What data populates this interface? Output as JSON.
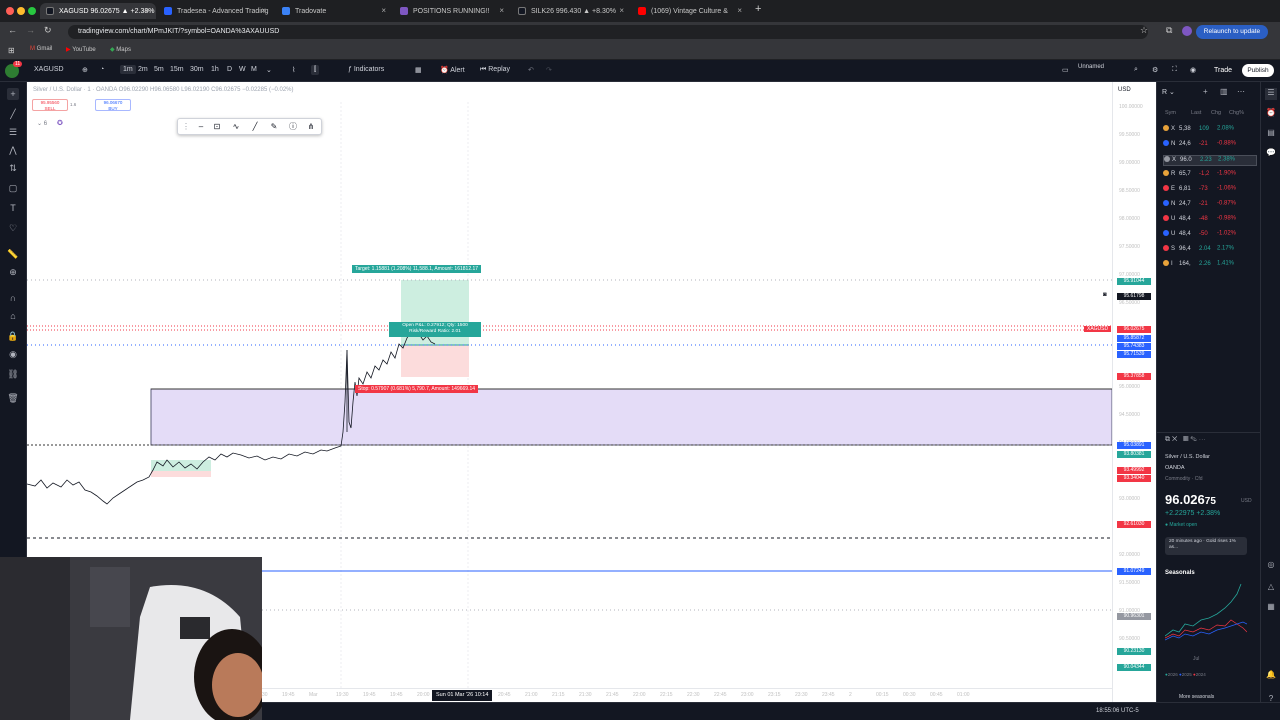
{
  "browser": {
    "tabs": [
      {
        "label": "XAGUSD 96.02675 ▲ +2.38%",
        "active": true
      },
      {
        "label": "Tradesea - Advanced Trading"
      },
      {
        "label": "Tradovate"
      },
      {
        "label": "POSITIONS RUNNING!!"
      },
      {
        "label": "SILK26 996.430 ▲ +8.30%"
      },
      {
        "label": "(1069) Vintage Culture &"
      }
    ],
    "url": "tradingview.com/chart/MPmJKIT/?symbol=OANDA%3AXAUUSD",
    "relaunch_label": "Relaunch to update",
    "bookmarks": [
      "Gmail",
      "YouTube",
      "Maps"
    ]
  },
  "toolbar": {
    "avatar_badge": "11",
    "symbol": "XAGUSD",
    "intervals": [
      "1m",
      "2m",
      "5m",
      "15m",
      "30m",
      "1h",
      "D",
      "W",
      "M"
    ],
    "active_interval": "1m",
    "indicators_label": "Indicators",
    "alert_label": "Alert",
    "replay_label": "Replay",
    "layout_label": "Unnamed",
    "trade_label": "Trade",
    "publish_label": "Publish"
  },
  "chart": {
    "legend": "Silver / U.S. Dollar · 1 · OANDA   O96.02290 H96.06580 L96.02190 C96.02675 −0.02285 (−0.02%)",
    "sell": {
      "price": "95.95560",
      "label": "SELL"
    },
    "buy": {
      "price": "96.06670",
      "label": "BUY"
    },
    "spread": "1.6",
    "position": {
      "target": "Target: 1.15881 (1.208%) 11,588.1, Amount: 161812.17",
      "open": "Open P&L: 0.27912; Qty: 1500",
      "ratio": "Risk/Reward Ratio: 2.01",
      "stop": "Stop: 0.57907 (0.681%) 5,790.7, Amount: 149669.14"
    },
    "price_tag": "XAGUSD",
    "crosshair_time": "Sun 01 Mar '26  10:14",
    "price_labels": [
      {
        "text": "95.91044",
        "color": "#26a69a"
      },
      {
        "text": "95.61798",
        "color": "#131722"
      },
      {
        "text": "96.02675",
        "color": "#f23645"
      },
      {
        "text": "95.85872",
        "color": "#2962ff"
      },
      {
        "text": "95.74383",
        "color": "#2962ff"
      },
      {
        "text": "95.71539",
        "color": "#2962ff"
      },
      {
        "text": "95.37858",
        "color": "#f23645"
      },
      {
        "text": "95.03891",
        "color": "#2962ff"
      },
      {
        "text": "93.80381",
        "color": "#26a69a"
      },
      {
        "text": "93.49992",
        "color": "#f23645"
      },
      {
        "text": "93.34040",
        "color": "#f23645"
      },
      {
        "text": "92.61030",
        "color": "#f23645"
      },
      {
        "text": "91.07249",
        "color": "#2962ff"
      },
      {
        "text": "90.96301",
        "color": "#9598a1"
      },
      {
        "text": "90.23130",
        "color": "#26a69a"
      },
      {
        "text": "90.04344",
        "color": "#26a69a"
      }
    ],
    "price_ticks": [
      "100.00000",
      "99.50000",
      "99.00000",
      "98.50000",
      "98.00000",
      "97.50000",
      "97.00000",
      "96.50000",
      "95.00000",
      "94.50000",
      "94.00000",
      "93.00000",
      "92.00000",
      "91.50000",
      "91.00000",
      "90.50000"
    ],
    "time_ticks": [
      "18:30",
      "19:45",
      "Mar",
      "19:30",
      "19:45",
      "19:45",
      "20:00",
      "20:15",
      "20:30",
      "20:45",
      "21:00",
      "21:15",
      "21:30",
      "21:45",
      "22:00",
      "22:15",
      "22:30",
      "22:45",
      "23:00",
      "23:15",
      "23:30",
      "23:45",
      "2",
      "00:15",
      "00:30",
      "00:45",
      "01:00"
    ],
    "currency": "USD"
  },
  "watchlist": {
    "header": "R",
    "columns": [
      "Sym",
      "Last",
      "Chg",
      "Chg%"
    ],
    "items": [
      {
        "sym": "X",
        "last": "5,38",
        "chg": "109",
        "pct": "2.08%",
        "color": "#26a69a",
        "ic": "#e8a23a"
      },
      {
        "sym": "N",
        "last": "24,6",
        "chg": "-21",
        "pct": "-0.88%",
        "color": "#f23645",
        "ic": "#2962ff"
      },
      {
        "sym": "X",
        "last": "96.0",
        "chg": "2.23",
        "pct": "2.38%",
        "color": "#26a69a",
        "ic": "#9598a1"
      },
      {
        "sym": "R",
        "last": "65,7",
        "chg": "-1,2",
        "pct": "-1.90%",
        "color": "#f23645",
        "ic": "#e8a23a"
      },
      {
        "sym": "E",
        "last": "6,81",
        "chg": "-73",
        "pct": "-1.06%",
        "color": "#f23645",
        "ic": "#f23645"
      },
      {
        "sym": "N",
        "last": "24,7",
        "chg": "-21",
        "pct": "-0.87%",
        "color": "#f23645",
        "ic": "#2962ff"
      },
      {
        "sym": "U",
        "last": "48,4",
        "chg": "-48",
        "pct": "-0.98%",
        "color": "#f23645",
        "ic": "#f23645"
      },
      {
        "sym": "U",
        "last": "48,4",
        "chg": "-50",
        "pct": "-1.02%",
        "color": "#f23645",
        "ic": "#2962ff"
      },
      {
        "sym": "S",
        "last": "96,4",
        "chg": "2.04",
        "pct": "2.17%",
        "color": "#26a69a",
        "ic": "#f23645"
      },
      {
        "sym": "I",
        "last": "164,",
        "chg": "2.26",
        "pct": "1.41%",
        "color": "#26a69a",
        "ic": "#e8a23a"
      }
    ]
  },
  "details": {
    "name": "Silver / U.S. Dollar",
    "exchange": "OANDA",
    "category": "Commodity · Cfd",
    "price_main": "96.026",
    "price_tail": "75",
    "currency": "USD",
    "change": "+2.22975 +2.38%",
    "market": "Market open",
    "news": "20 minutes ago · Gold rises 1% as...",
    "seasonals": "Seasonals",
    "legend": [
      "2026",
      "2025",
      "2024"
    ],
    "more": "More seasonals",
    "month": "Jul"
  },
  "status": {
    "clock": "18:55:06 UTC-5"
  }
}
